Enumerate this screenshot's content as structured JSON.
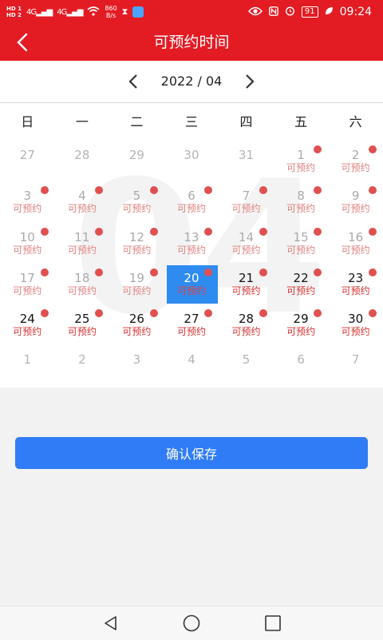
{
  "status": {
    "hd1": "HD 1",
    "hd2": "HD 2",
    "sig1": "4G",
    "sig2": "4G",
    "net_speed": "860",
    "net_unit": "B/s",
    "battery": "91",
    "time": "09:24"
  },
  "header": {
    "title": "可预约时间"
  },
  "month": {
    "label": "2022 / 04"
  },
  "weekdays": [
    "日",
    "一",
    "二",
    "三",
    "四",
    "五",
    "六"
  ],
  "watermark": "04",
  "available_label": "可预约",
  "days": [
    {
      "d": "27",
      "state": "dim",
      "avail": false
    },
    {
      "d": "28",
      "state": "dim",
      "avail": false
    },
    {
      "d": "29",
      "state": "dim",
      "avail": false
    },
    {
      "d": "30",
      "state": "dim",
      "avail": false
    },
    {
      "d": "31",
      "state": "dim",
      "avail": false
    },
    {
      "d": "1",
      "state": "faded",
      "avail": true
    },
    {
      "d": "2",
      "state": "faded",
      "avail": true
    },
    {
      "d": "3",
      "state": "faded",
      "avail": true
    },
    {
      "d": "4",
      "state": "faded",
      "avail": true
    },
    {
      "d": "5",
      "state": "faded",
      "avail": true
    },
    {
      "d": "6",
      "state": "faded",
      "avail": true
    },
    {
      "d": "7",
      "state": "faded",
      "avail": true
    },
    {
      "d": "8",
      "state": "faded",
      "avail": true
    },
    {
      "d": "9",
      "state": "faded",
      "avail": true
    },
    {
      "d": "10",
      "state": "faded",
      "avail": true
    },
    {
      "d": "11",
      "state": "faded",
      "avail": true
    },
    {
      "d": "12",
      "state": "faded",
      "avail": true
    },
    {
      "d": "13",
      "state": "faded",
      "avail": true
    },
    {
      "d": "14",
      "state": "faded",
      "avail": true
    },
    {
      "d": "15",
      "state": "faded",
      "avail": true
    },
    {
      "d": "16",
      "state": "faded",
      "avail": true
    },
    {
      "d": "17",
      "state": "faded",
      "avail": true
    },
    {
      "d": "18",
      "state": "faded",
      "avail": true
    },
    {
      "d": "19",
      "state": "faded",
      "avail": true
    },
    {
      "d": "20",
      "state": "selected",
      "avail": true
    },
    {
      "d": "21",
      "state": "active",
      "avail": true
    },
    {
      "d": "22",
      "state": "active",
      "avail": true
    },
    {
      "d": "23",
      "state": "active",
      "avail": true
    },
    {
      "d": "24",
      "state": "active",
      "avail": true
    },
    {
      "d": "25",
      "state": "active",
      "avail": true
    },
    {
      "d": "26",
      "state": "active",
      "avail": true
    },
    {
      "d": "27",
      "state": "active",
      "avail": true
    },
    {
      "d": "28",
      "state": "active",
      "avail": true
    },
    {
      "d": "29",
      "state": "active",
      "avail": true
    },
    {
      "d": "30",
      "state": "active",
      "avail": true
    },
    {
      "d": "1",
      "state": "dim",
      "avail": false
    },
    {
      "d": "2",
      "state": "dim",
      "avail": false
    },
    {
      "d": "3",
      "state": "dim",
      "avail": false
    },
    {
      "d": "4",
      "state": "dim",
      "avail": false
    },
    {
      "d": "5",
      "state": "dim",
      "avail": false
    },
    {
      "d": "6",
      "state": "dim",
      "avail": false
    },
    {
      "d": "7",
      "state": "dim",
      "avail": false
    }
  ],
  "footer": {
    "save_label": "确认保存"
  },
  "colors": {
    "brand_red": "#e31b23",
    "selected_blue": "#2e8bf0",
    "button_blue": "#2f7cf6",
    "available_red": "#e05050"
  }
}
